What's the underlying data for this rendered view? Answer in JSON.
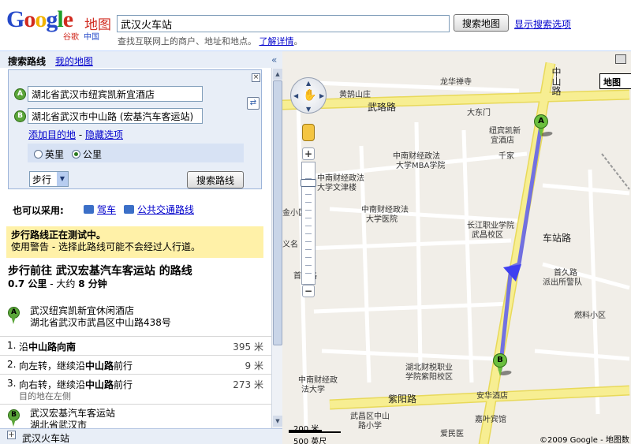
{
  "header": {
    "logo_text": "Google",
    "logo_sub_cn": "谷歌",
    "logo_sub_region": "中国",
    "product": "地图",
    "search_value": "武汉火车站",
    "search_button": "搜索地图",
    "show_options": "显示搜索选项",
    "hint": "查找互联网上的商户、地址和地点。",
    "hint_link": "了解详情",
    "hint_end": "。"
  },
  "tabs": {
    "active": "搜索路线",
    "other": "我的地图",
    "collapse": "«"
  },
  "form": {
    "close": "×",
    "from_marker": "A",
    "from_value": "湖北省武汉市纽宾凯新宜酒店",
    "to_marker": "B",
    "to_value": "湖北省武汉市中山路 (宏基汽车客运站)",
    "add_destination": "添加目的地",
    "separator": " - ",
    "hide_options": "隐藏选项",
    "unit_miles": "英里",
    "unit_km": "公里",
    "mode": "步行",
    "route_button": "搜索路线"
  },
  "alternatives": {
    "label": "也可以采用:",
    "drive": "驾车",
    "transit": "公共交通路线"
  },
  "warning": {
    "title": "步行路线正在测试中。",
    "body": "使用警告 - 选择此路线可能不会经过人行道。"
  },
  "directions": {
    "title": "步行前往 武汉宏基汽车客运站 的路线",
    "distance": "0.7 公里",
    "dash": " - 大约 ",
    "time": "8 分钟",
    "start": {
      "marker": "A",
      "name": "武汉纽宾凯新宜休闲酒店",
      "address": "湖北省武汉市武昌区中山路438号"
    },
    "steps": [
      {
        "num": "1.",
        "pre": "沿",
        "road": "中山路",
        "post": "向南",
        "dist": "395 米",
        "note": ""
      },
      {
        "num": "2.",
        "pre": "向左转，继续沿",
        "road": "中山路",
        "post": "前行",
        "dist": "9 米",
        "note": ""
      },
      {
        "num": "3.",
        "pre": "向右转，继续沿",
        "road": "中山路",
        "post": "前行",
        "dist": "273 米",
        "note": "目的地在左侧"
      }
    ],
    "end": {
      "marker": "B",
      "name": "武汉宏基汽车客运站",
      "address": "湖北省武汉市"
    }
  },
  "bottom": {
    "plus": "+",
    "label": "武汉火车站"
  },
  "map": {
    "type_button": "地图",
    "labels": {
      "longhua": "龙华禅寺",
      "huangheshan": "黄鹄山庄",
      "wuluo": "武珞路",
      "dadongmen": "大东门",
      "niubin": "纽宾凯新",
      "yidian": "宜酒店",
      "qianjia": "千家",
      "zhongshan": "中山路",
      "zhongnan_law": "中南财经政法",
      "mba": "大学MBA学院",
      "wenjin": "大学文津楼",
      "zhongnan_law2": "中南财经政法",
      "hospital": "大学医院",
      "xiaoqu": "金小区",
      "yiming": "义名",
      "changjiang": "长江职业学院",
      "wuchang_campus": "武昌校区",
      "chezhan": "车站路",
      "shoujiu": "首久路",
      "paichusuo": "派出所警队",
      "ranliao": "燃料小区",
      "hubei_finance": "湖北财税职业",
      "ziyang_campus": "学院紫阳校区",
      "zhongnan3": "中南财经政",
      "fada": "法大学",
      "ziyang": "紫阳路",
      "anhua": "安华酒店",
      "wuchangzhongshan": "武昌区中山",
      "xiaoxue": "路小学",
      "jiaye": "嘉叶宾馆",
      "aimin": "爱民医",
      "shouyi": "首义路",
      "ziyang_short": "紫阳路",
      "luozi": "罗"
    },
    "scale_metric": "200 米",
    "scale_imperial": "500 英尺",
    "copyright": "©2009 Google - 地图数",
    "pin_a": "A",
    "pin_b": "B"
  },
  "colors": {
    "route": "#5b5bf0",
    "road_major": "#f5e97a",
    "road_minor": "#ffffff",
    "map_bg": "#f1eee8",
    "link": "#0000cc",
    "warning_bg": "#fff1a8"
  }
}
